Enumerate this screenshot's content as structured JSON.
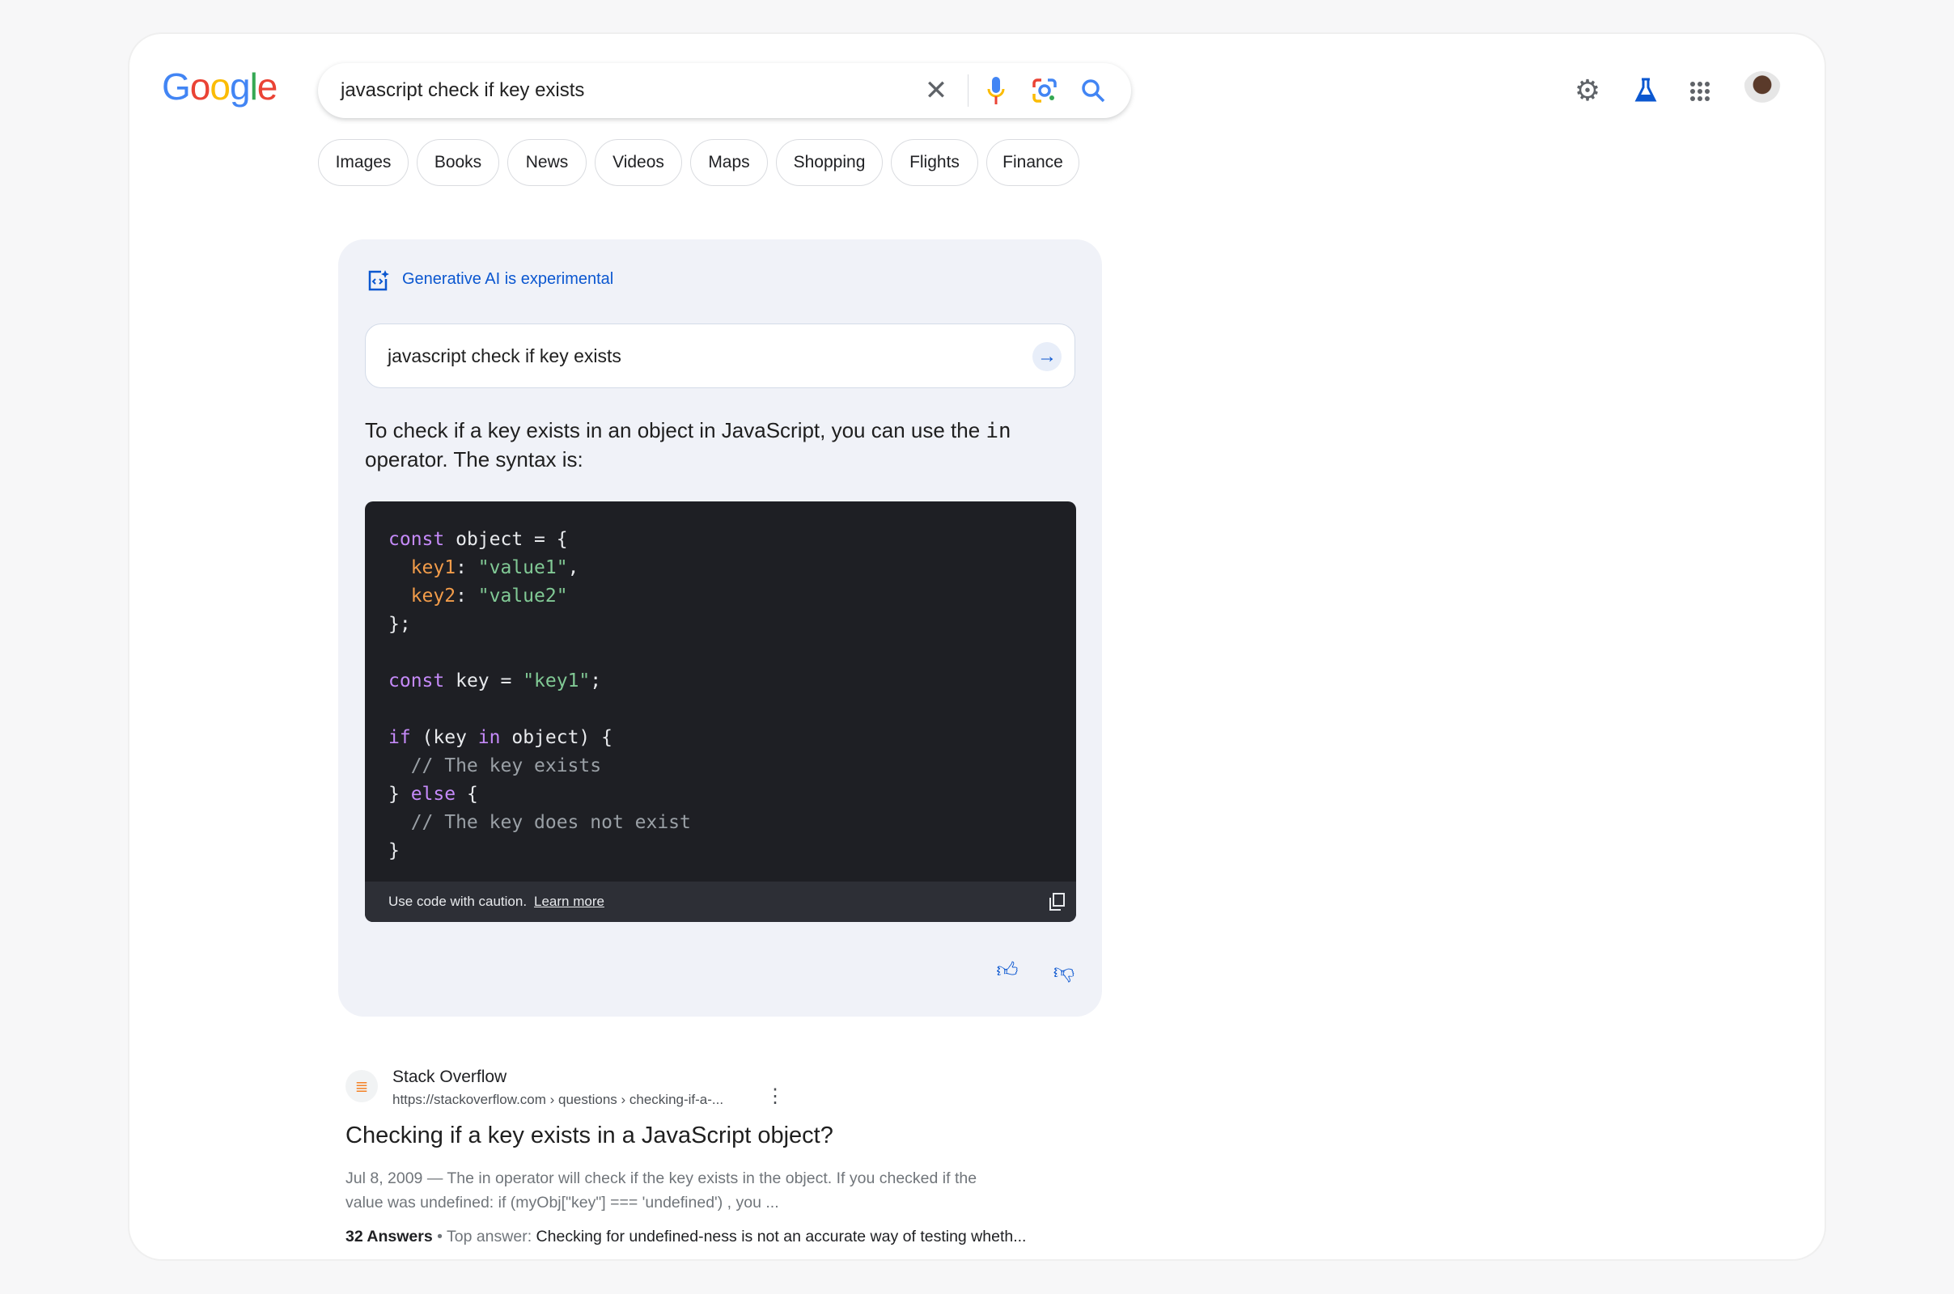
{
  "header": {
    "logo": "Google",
    "query": "javascript check if key exists"
  },
  "chips": [
    "Images",
    "Books",
    "News",
    "Videos",
    "Maps",
    "Shopping",
    "Flights",
    "Finance"
  ],
  "ai": {
    "label": "Generative AI is experimental",
    "query": "javascript check if key exists",
    "answer_pre": "To check if a key exists in an object in JavaScript, you can use the",
    "answer_code": "in",
    "answer_post": " operator.  The syntax is:",
    "caution": "Use code with caution.",
    "learn_more": "Learn more"
  },
  "code": [
    [
      [
        "kw",
        "const"
      ],
      [
        "",
        "  object = {"
      ]
    ],
    [
      [
        "",
        "  "
      ],
      [
        "pr",
        "key1"
      ],
      [
        "",
        ": "
      ],
      [
        "st",
        "\"value1\""
      ],
      [
        "",
        ","
      ]
    ],
    [
      [
        "",
        "  "
      ],
      [
        "pr",
        "key2"
      ],
      [
        "",
        ": "
      ],
      [
        "st",
        "\"value2\""
      ]
    ],
    [
      [
        "",
        "};"
      ]
    ],
    [
      [
        "",
        ""
      ]
    ],
    [
      [
        "kw",
        "const"
      ],
      [
        "",
        " key = "
      ],
      [
        "st",
        "\"key1\""
      ],
      [
        "",
        ";"
      ]
    ],
    [
      [
        "",
        ""
      ]
    ],
    [
      [
        "kw",
        "if"
      ],
      [
        "",
        " (key "
      ],
      [
        "kw",
        "in"
      ],
      [
        "",
        " object) {"
      ]
    ],
    [
      [
        "cm",
        "  // The key exists"
      ]
    ],
    [
      [
        "",
        "} "
      ],
      [
        "kw",
        "else"
      ],
      [
        "",
        " {"
      ]
    ],
    [
      [
        "cm",
        "  // The key does not exist"
      ]
    ],
    [
      [
        "",
        "}"
      ]
    ]
  ],
  "result": {
    "site": "Stack Overflow",
    "url": "https://stackoverflow.com › questions › checking-if-a-...",
    "title": "Checking if a key exists in a JavaScript object?",
    "snippet1": "Jul 8, 2009 — The in operator will check if the key exists in the object. If you checked if the",
    "snippet2": "value was undefined: if (myObj[\"key\"] === 'undefined') , you ...",
    "answers": "32 Answers",
    "sep": " • Top answer: ",
    "top_answer": "Checking for undefined-ness is not an accurate way of testing wheth..."
  },
  "colors": {
    "accent": "#0b57d0",
    "code_bg": "#1e1f24"
  }
}
